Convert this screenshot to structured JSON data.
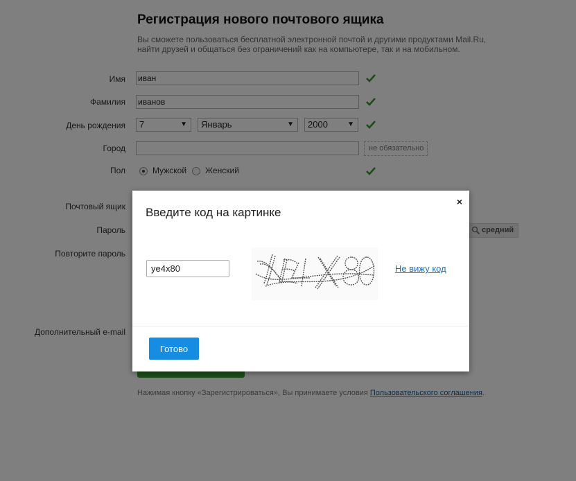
{
  "page": {
    "title": "Регистрация нового почтового ящика",
    "subtitle_line1": "Вы сможете пользоваться бесплатной электронной почтой и другими продуктами Mail.Ru,",
    "subtitle_line2": "найти друзей и общаться без ограничений как на компьютере, так и на мобильном."
  },
  "form": {
    "first_name": {
      "label": "Имя",
      "value": "иван"
    },
    "last_name": {
      "label": "Фамилия",
      "value": "иванов"
    },
    "birthday": {
      "label": "День рождения",
      "day": "7",
      "month": "Январь",
      "year": "2000"
    },
    "city": {
      "label": "Город",
      "value": "",
      "hint": "не обязательно"
    },
    "gender": {
      "label": "Пол",
      "male": "Мужской",
      "female": "Женский",
      "selected": "male"
    },
    "mailbox": {
      "label": "Почтовый ящик"
    },
    "password": {
      "label": "Пароль",
      "strength": "средний"
    },
    "repeat_password": {
      "label": "Повторите пароль"
    },
    "extra_email": {
      "label": "Дополнительный e-mail"
    },
    "terms_prefix": "Нажимая кнопку «Зарегистрироваться», Вы принимаете условия ",
    "terms_link": "Пользовательского соглашения",
    "terms_suffix": "."
  },
  "modal": {
    "title": "Введите код на картинке",
    "close_icon": "×",
    "code_value": "ye4x80",
    "captcha_text": "YE4X80",
    "cant_see_link": "Не вижу код",
    "done_button": "Готово"
  },
  "colors": {
    "check": "#3a9a2e",
    "primary_button": "#168de2",
    "register_button": "#3f9c35",
    "overlay": "rgba(0,0,0,0.5)"
  }
}
